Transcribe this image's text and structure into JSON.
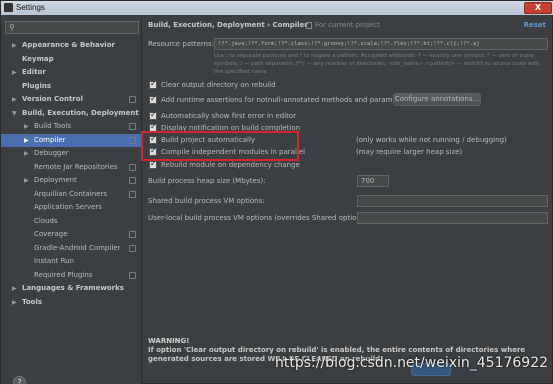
{
  "window": {
    "title": "Settings",
    "close_label": "X"
  },
  "sidebar": {
    "search_placeholder": "",
    "items": [
      {
        "label": "Appearance & Behavior",
        "level": 0,
        "expanded": false,
        "bold": true
      },
      {
        "label": "Keymap",
        "level": 0,
        "bold": true
      },
      {
        "label": "Editor",
        "level": 0,
        "expanded": false,
        "bold": true
      },
      {
        "label": "Plugins",
        "level": 0,
        "bold": true
      },
      {
        "label": "Version Control",
        "level": 0,
        "expanded": false,
        "bold": true,
        "project": true
      },
      {
        "label": "Build, Execution, Deployment",
        "level": 0,
        "expanded": true,
        "bold": true
      },
      {
        "label": "Build Tools",
        "level": 1,
        "expanded": false,
        "project": true
      },
      {
        "label": "Compiler",
        "level": 1,
        "expanded": false,
        "selected": true,
        "project": true
      },
      {
        "label": "Debugger",
        "level": 1,
        "expanded": false
      },
      {
        "label": "Remote Jar Repositories",
        "level": 1,
        "project": true
      },
      {
        "label": "Deployment",
        "level": 1,
        "expanded": false,
        "project": true
      },
      {
        "label": "Arquillian Containers",
        "level": 1,
        "project": true
      },
      {
        "label": "Application Servers",
        "level": 1
      },
      {
        "label": "Clouds",
        "level": 1
      },
      {
        "label": "Coverage",
        "level": 1,
        "project": true
      },
      {
        "label": "Gradle-Android Compiler",
        "level": 1,
        "project": true
      },
      {
        "label": "Instant Run",
        "level": 1
      },
      {
        "label": "Required Plugins",
        "level": 1,
        "project": true
      },
      {
        "label": "Languages & Frameworks",
        "level": 0,
        "expanded": false,
        "bold": true
      },
      {
        "label": "Tools",
        "level": 0,
        "expanded": false,
        "bold": true
      }
    ],
    "help_label": "?"
  },
  "header": {
    "breadcrumb": "Build, Execution, Deployment  ›  Compiler",
    "scope": "For current project",
    "reset": "Reset"
  },
  "resource_patterns": {
    "label": "Resource patterns:",
    "value": "!?*.java;!?*.form;!?*.class;!?*.groovy;!?*.scala;!?*.flex;!?*.kt;!?*.clj;!?*.aj",
    "hint": "Use ; to separate patterns and ! to negate a pattern. Accepted wildcards: ? — exactly one symbol; * — zero or more symbols; / — path separator; /**/ — any number of directories; <dir_name>:<pattern> — restrict to source roots with the specified name"
  },
  "options": {
    "clear_output": {
      "label": "Clear output directory on rebuild",
      "checked": true
    },
    "runtime_assertions": {
      "label": "Add runtime assertions for notnull-annotated methods and parameters",
      "checked": true
    },
    "configure_annotations": "Configure annotations...",
    "show_first_error": {
      "label": "Automatically show first error in editor",
      "checked": true
    },
    "display_notification": {
      "label": "Display notification on build completion",
      "checked": true
    },
    "build_automatically": {
      "label": "Build project automatically",
      "checked": true,
      "note": "(only works while not running / debugging)"
    },
    "compile_parallel": {
      "label": "Compile independent modules in parallel",
      "checked": true,
      "note": "(may require larger heap size)"
    },
    "rebuild_module": {
      "label": "Rebuild module on dependency change",
      "checked": true
    }
  },
  "heap": {
    "label": "Build process heap size (Mbytes):",
    "value": "700"
  },
  "shared_vm": {
    "label": "Shared build process VM options:",
    "value": ""
  },
  "user_vm": {
    "label": "User-local build process VM options (overrides Shared options):",
    "value": ""
  },
  "warning": {
    "title": "WARNING!",
    "text": "If option 'Clear output directory on rebuild' is enabled, the entire contents of directories where generated sources are stored WILL BE CLEARED on rebuild."
  },
  "watermark": "https://blog.csdn.net/weixin_45176922"
}
